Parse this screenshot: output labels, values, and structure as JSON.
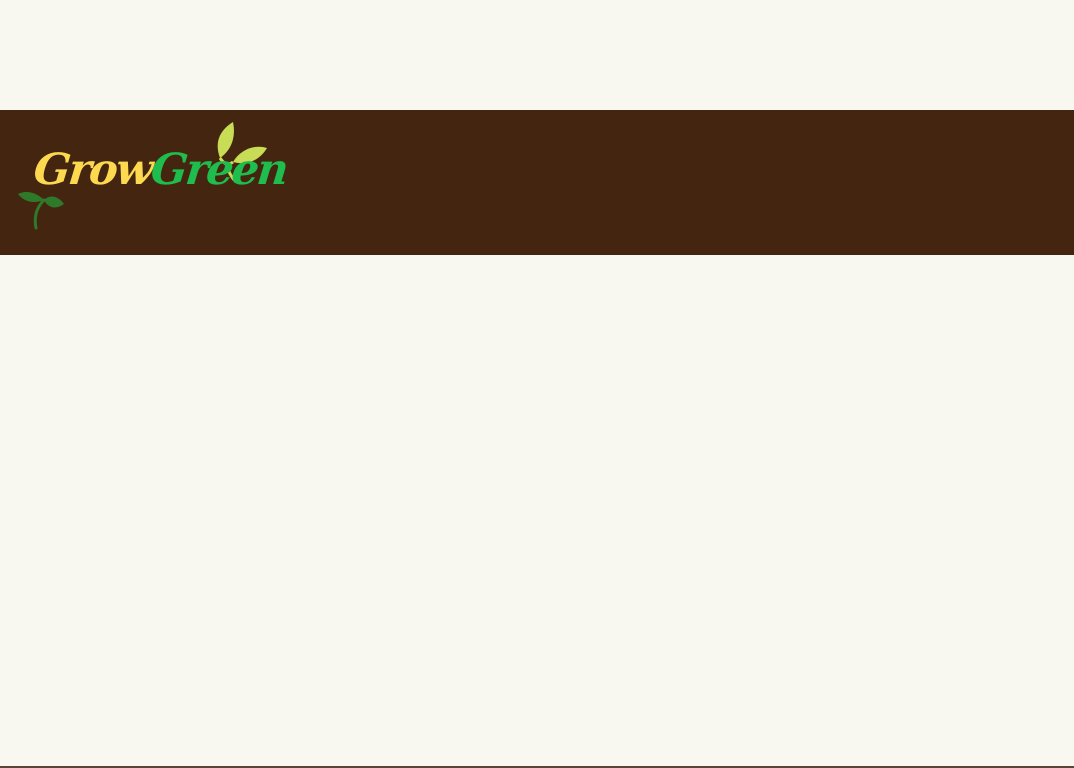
{
  "header": {
    "logo": {
      "text_part1": "Grow",
      "text_part2": "Green",
      "colors": {
        "grow": "#fdd94f",
        "green": "#1fbd4e",
        "leaf_light": "#c8dc56",
        "leaf_dark": "#2f7a2a"
      }
    },
    "background": "#442610"
  },
  "page": {
    "background": "#f8f7f0"
  }
}
